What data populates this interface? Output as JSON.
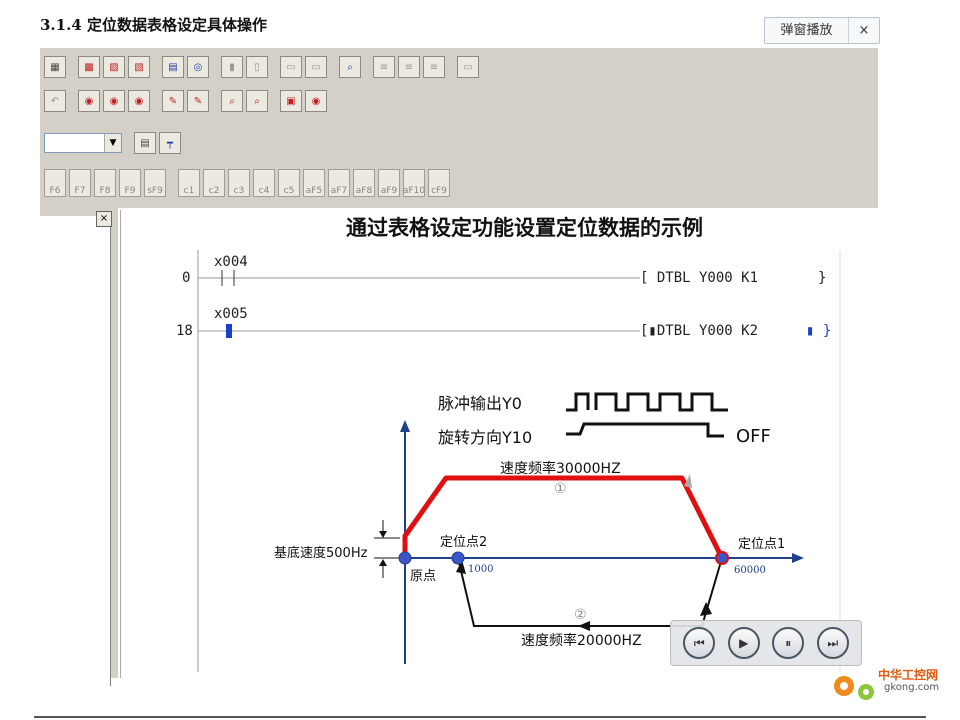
{
  "header": {
    "title": "3.1.4 定位数据表格设定具体操作",
    "popup_label": "弹窗播放",
    "close_label": "×"
  },
  "panel": {
    "close_label": "×"
  },
  "diagram": {
    "title": "通过表格设定功能设置定位数据的示例",
    "rung0": {
      "step": "0",
      "contact": "x004",
      "instruction": "[ DTBL  Y000  K1",
      "end": "}"
    },
    "rung1": {
      "step": "18",
      "contact": "x005",
      "instruction": "[▮DTBL  Y000  K2",
      "end": "▮ }"
    },
    "pulse_label": "脉冲输出Y0",
    "direction_label": "旋转方向Y10",
    "off_label": "OFF",
    "speed_top": "速度频率30000HZ",
    "speed_bottom": "速度频率20000HZ",
    "circle1": "①",
    "circle2": "②",
    "base_speed": "基底速度500Hz",
    "origin": "原点",
    "point2": "定位点2",
    "point2_value": "1000",
    "point1": "定位点1",
    "point1_value": "60000"
  },
  "media": {
    "prev_icon": "⏮",
    "play_icon": "▶",
    "pause_icon": "⏸",
    "next_icon": "⏭"
  },
  "logo": {
    "name": "中华工控网",
    "domain": "gkong.com"
  },
  "toolbar": {
    "fkeys": [
      "F6",
      "F7",
      "F8",
      "F9",
      "sF9",
      "c1",
      "c2",
      "c3",
      "c4",
      "c5",
      "aF5",
      "aF7",
      "aF8",
      "aF9",
      "aF10",
      "cF9"
    ]
  }
}
